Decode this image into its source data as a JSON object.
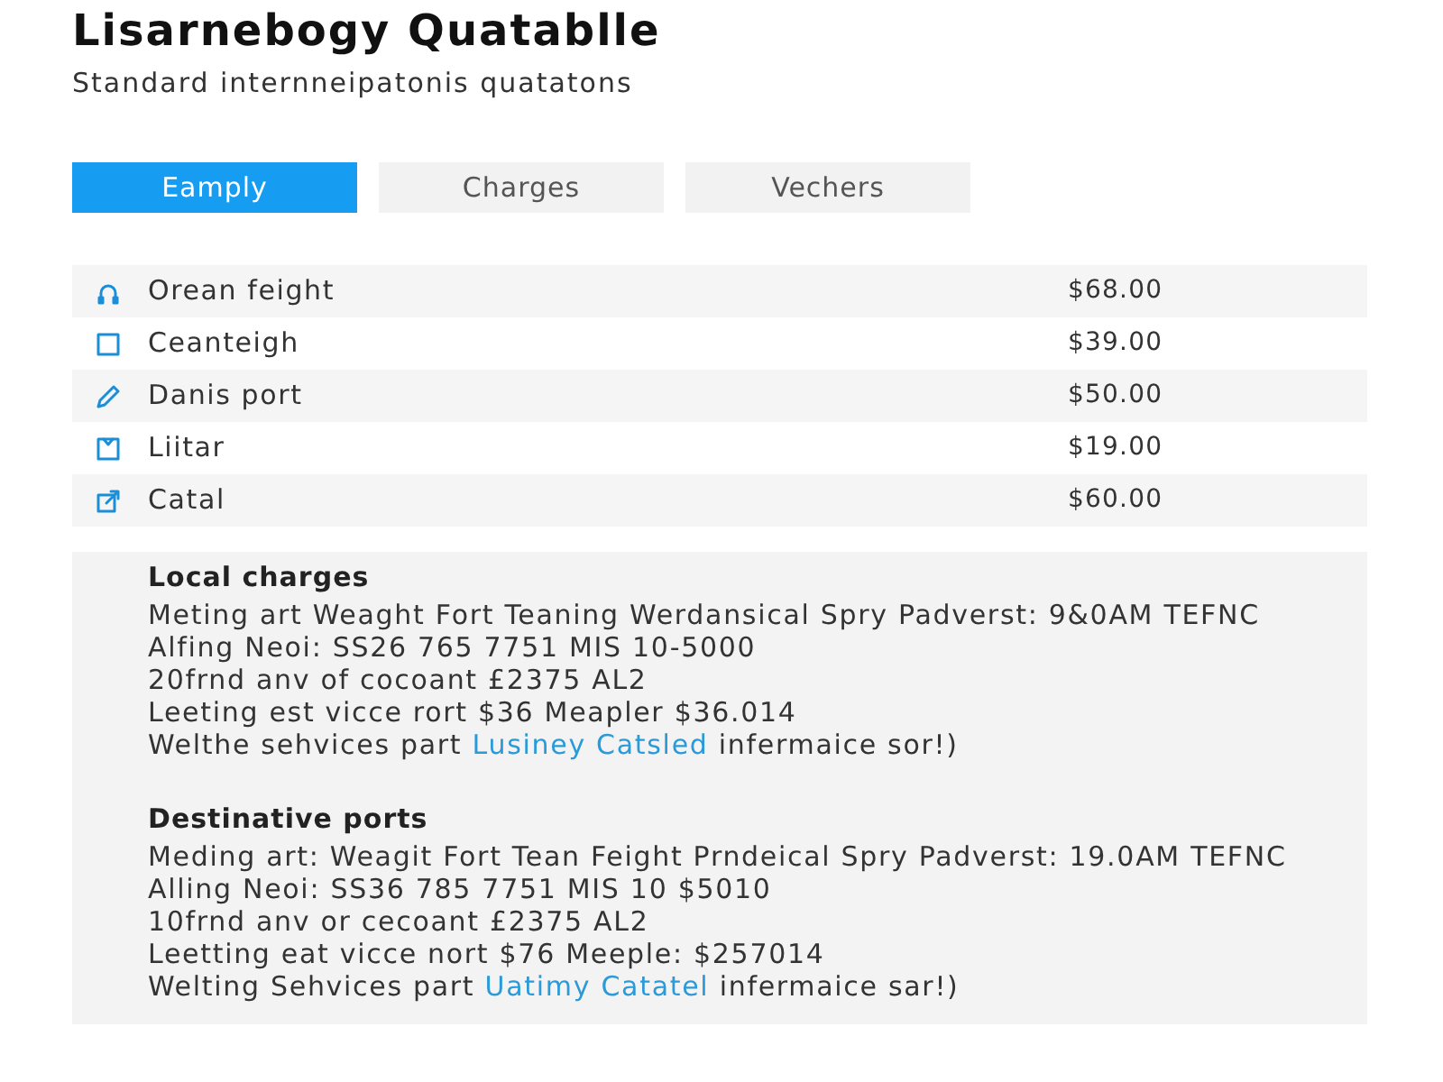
{
  "header": {
    "title": "Lisarnebogy Quatablle",
    "subtitle": "Standard internneipatonis quatatons"
  },
  "tabs": [
    {
      "label": "Eamply",
      "selected": true
    },
    {
      "label": "Charges",
      "selected": false
    },
    {
      "label": "Vechers",
      "selected": false
    }
  ],
  "items": [
    {
      "name": "Orean feight",
      "price": "$68.00"
    },
    {
      "name": "Ceanteigh",
      "price": "$39.00"
    },
    {
      "name": "Danis port",
      "price": "$50.00"
    },
    {
      "name": "Liitar",
      "price": "$19.00"
    },
    {
      "name": "Catal",
      "price": "$60.00"
    }
  ],
  "sections": [
    {
      "heading": "Local charges",
      "lines": [
        {
          "text": "Meting art Weaght Fort Teaning Werdansical Spry Padverst: 9&0AM TEFNC"
        },
        {
          "text": "Alfing Neoi: SS26 765 7751 MIS 10-5000"
        },
        {
          "text": "20frnd anv of cocoant £2375 AL2"
        },
        {
          "text": "Leeting est vicce rort $36 Meapler $36.014"
        },
        {
          "text": "Welthe sehvices part",
          "link": "Lusiney Catsled",
          "rest": "infermaice sor!)"
        }
      ]
    },
    {
      "heading": "Destinative ports",
      "lines": [
        {
          "text": "Meding art: Weagit Fort Tean Feight Prndeical Spry Padverst: 19.0AM TEFNC"
        },
        {
          "text": "Alling Neoi: SS36 785 7751 MIS 10 $5010"
        },
        {
          "text": "10frnd anv or cecoant £2375 AL2"
        },
        {
          "text": "Leetting eat vicce nort $76 Meeple: $257014"
        },
        {
          "text": "Welting Sehvices part",
          "link": "Uatimy Catatel",
          "rest": "infermaice sar!)"
        }
      ]
    }
  ]
}
